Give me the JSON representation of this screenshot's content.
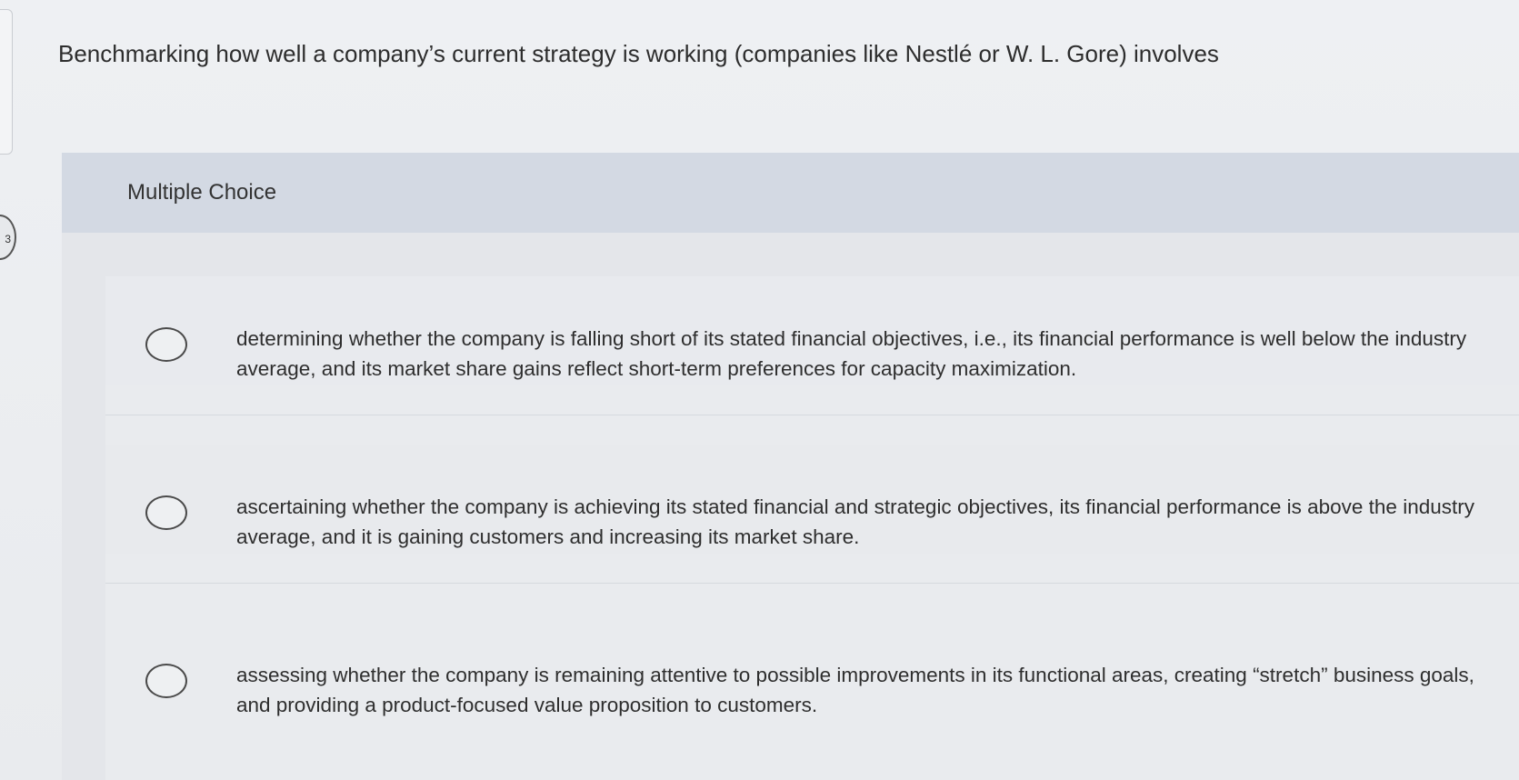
{
  "question": {
    "text": "Benchmarking how well a company’s current strategy is working (companies like Nestlé or W. L. Gore) involves"
  },
  "section": {
    "label": "Multiple Choice"
  },
  "left_edge": {
    "marker_text": "3"
  },
  "options": [
    {
      "text": "determining whether the company is falling short of its stated financial objectives, i.e., its financial performance is well below the industry average, and its market share gains reflect short-term preferences for capacity maximization."
    },
    {
      "text": "ascertaining whether the company is achieving its stated financial and strategic objectives, its financial performance is above the industry average, and it is gaining customers and increasing its market share."
    },
    {
      "text": "assessing whether the company is remaining attentive to possible improvements in its functional areas, creating “stretch” business goals, and providing a product-focused value proposition to customers."
    }
  ]
}
